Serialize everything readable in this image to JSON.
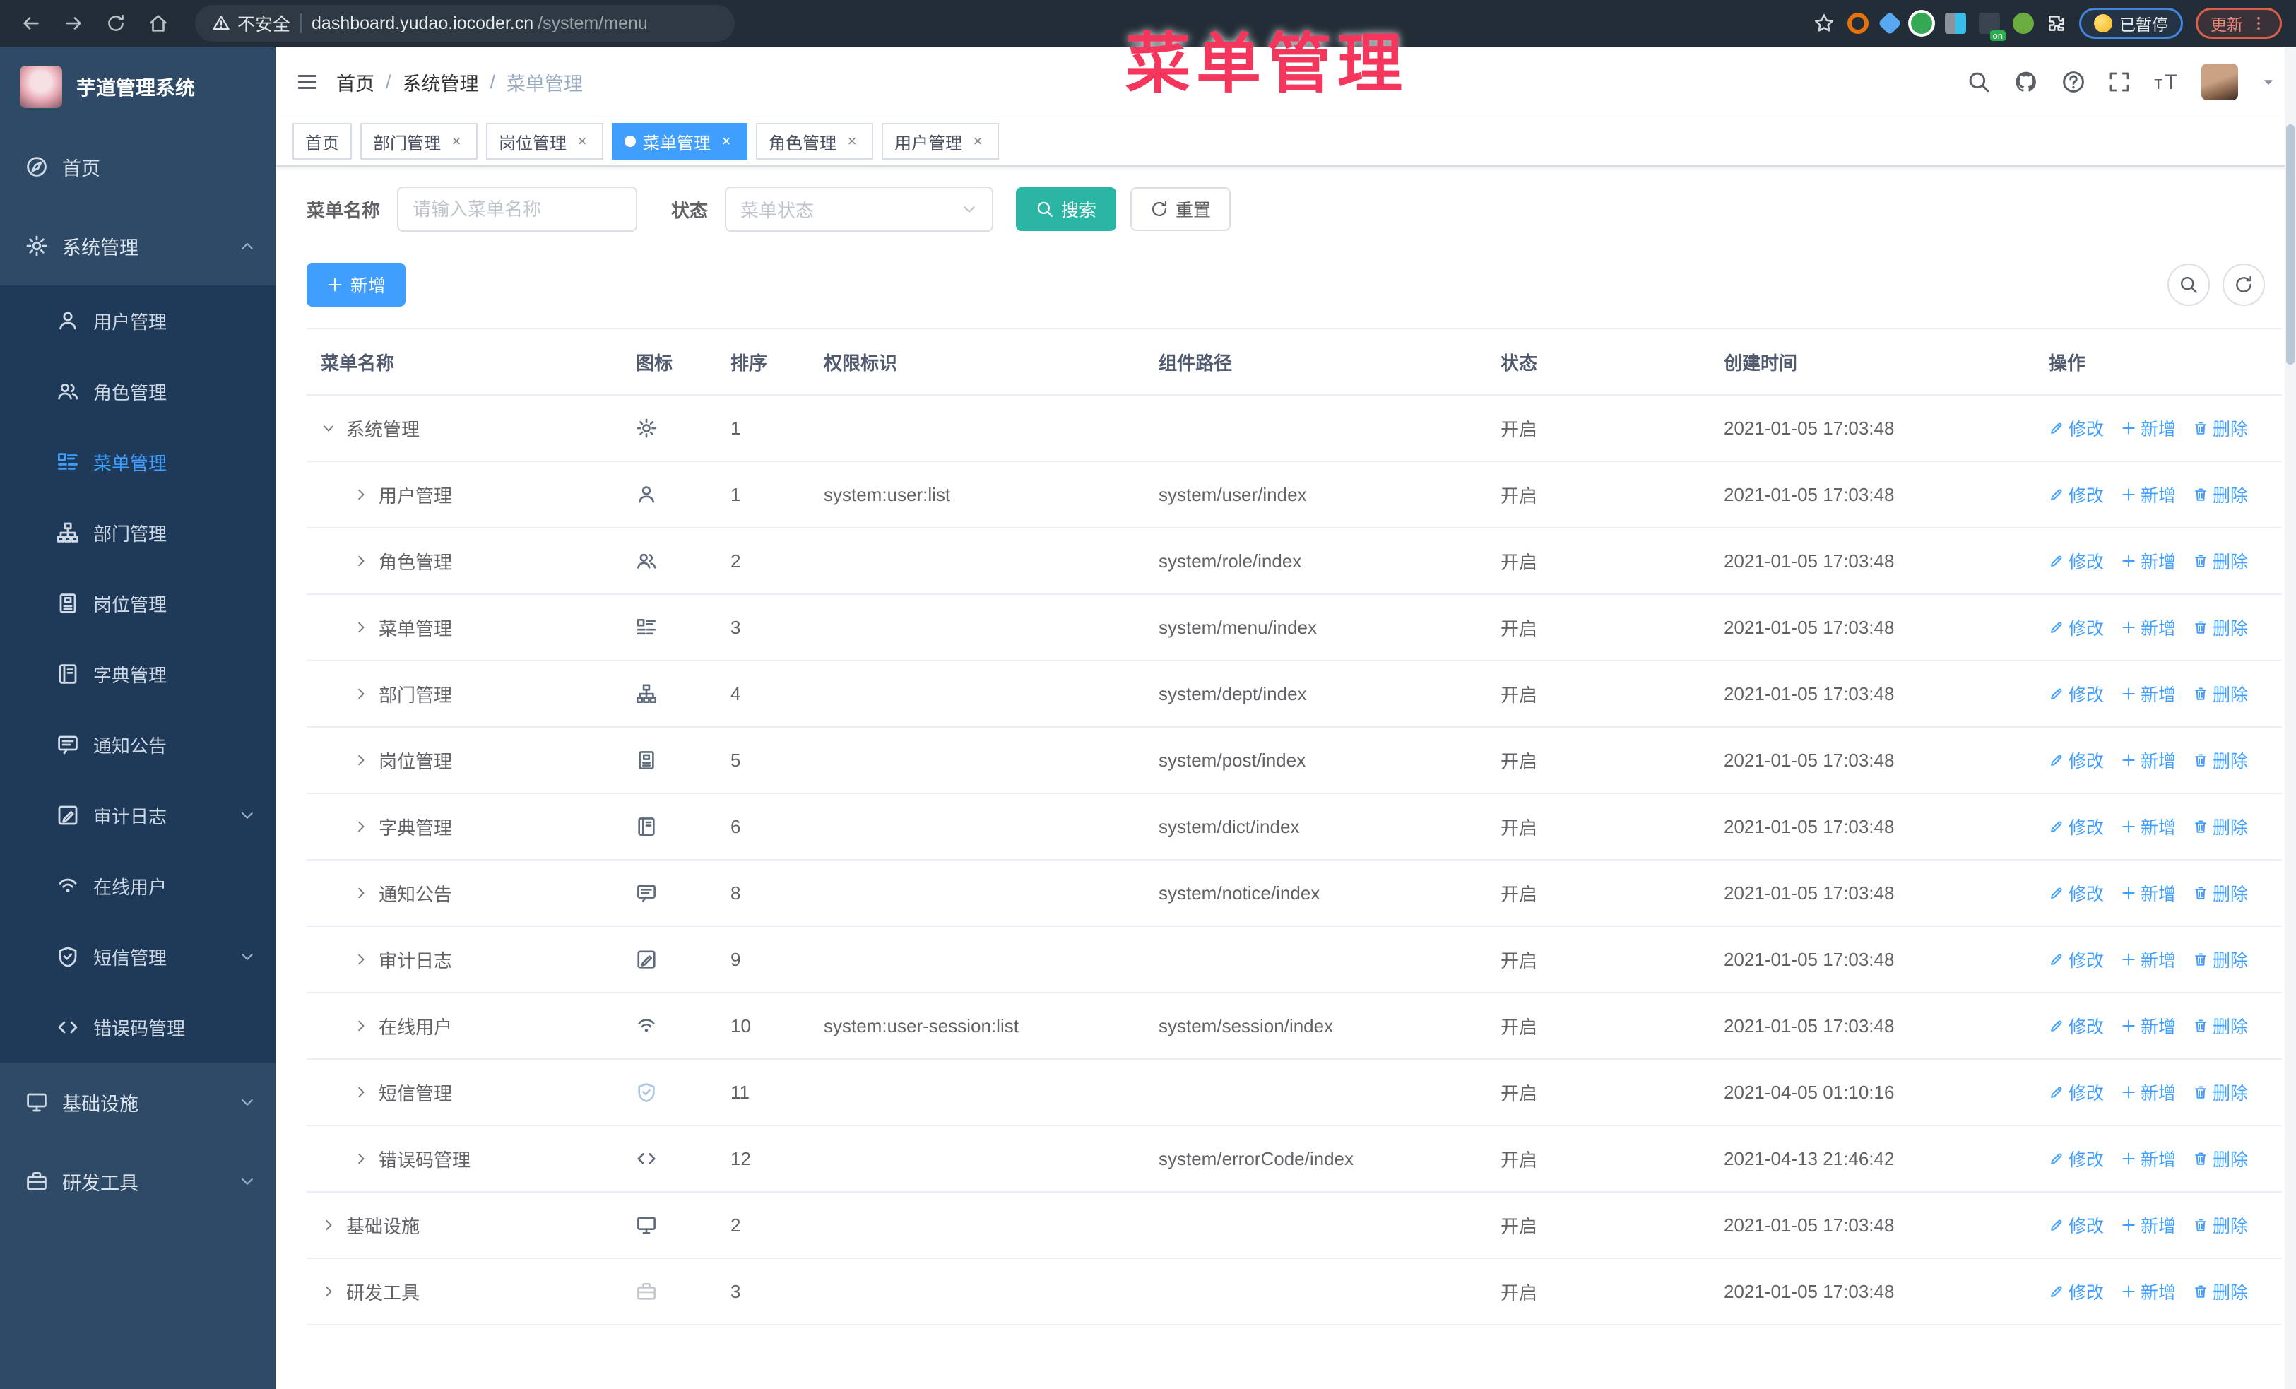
{
  "browser": {
    "security_label": "不安全",
    "url_host": "dashboard.yudao.iocoder.cn",
    "url_path": "/system/menu",
    "paused_badge": "已暂停",
    "update_button": "更新"
  },
  "overlay_title": "菜单管理",
  "colors": {
    "accent": "#409eff",
    "search_button": "#2ab5a5",
    "overlay": "#f4355c",
    "sidebar_bg": "#2e4a66",
    "submenu_bg": "#1e3a58"
  },
  "sidebar": {
    "app_title": "芋道管理系统",
    "items": [
      {
        "key": "home",
        "label": "首页",
        "icon": "guide",
        "level": 0
      },
      {
        "key": "system",
        "label": "系统管理",
        "icon": "gear",
        "level": 0,
        "chevron": "up"
      },
      {
        "key": "user",
        "label": "用户管理",
        "icon": "user",
        "level": 1
      },
      {
        "key": "role",
        "label": "角色管理",
        "icon": "users",
        "level": 1
      },
      {
        "key": "menu",
        "label": "菜单管理",
        "icon": "tree-table",
        "level": 1,
        "active": true
      },
      {
        "key": "dept",
        "label": "部门管理",
        "icon": "org-tree",
        "level": 1
      },
      {
        "key": "post",
        "label": "岗位管理",
        "icon": "id-badge",
        "level": 1
      },
      {
        "key": "dict",
        "label": "字典管理",
        "icon": "book",
        "level": 1
      },
      {
        "key": "notice",
        "label": "通知公告",
        "icon": "message",
        "level": 1
      },
      {
        "key": "audit",
        "label": "审计日志",
        "icon": "edit-doc",
        "level": 1,
        "chevron": "down"
      },
      {
        "key": "online",
        "label": "在线用户",
        "icon": "online",
        "level": 1
      },
      {
        "key": "sms",
        "label": "短信管理",
        "icon": "shield-check",
        "level": 1,
        "chevron": "down"
      },
      {
        "key": "errcode",
        "label": "错误码管理",
        "icon": "code",
        "level": 1
      },
      {
        "key": "infra",
        "label": "基础设施",
        "icon": "monitor",
        "level": 0,
        "chevron": "down"
      },
      {
        "key": "devtools",
        "label": "研发工具",
        "icon": "briefcase",
        "level": 0,
        "chevron": "down"
      }
    ]
  },
  "header": {
    "breadcrumb": [
      "首页",
      "系统管理",
      "菜单管理"
    ]
  },
  "tabs": [
    {
      "key": "home",
      "label": "首页",
      "closable": false,
      "active": false
    },
    {
      "key": "dept",
      "label": "部门管理",
      "closable": true,
      "active": false
    },
    {
      "key": "post",
      "label": "岗位管理",
      "closable": true,
      "active": false
    },
    {
      "key": "menu",
      "label": "菜单管理",
      "closable": true,
      "active": true
    },
    {
      "key": "role",
      "label": "角色管理",
      "closable": true,
      "active": false
    },
    {
      "key": "user",
      "label": "用户管理",
      "closable": true,
      "active": false
    }
  ],
  "filters": {
    "name_label": "菜单名称",
    "name_placeholder": "请输入菜单名称",
    "status_label": "状态",
    "status_placeholder": "菜单状态",
    "search_label": "搜索",
    "reset_label": "重置"
  },
  "toolbar": {
    "add_label": "新增"
  },
  "actions": {
    "edit": "修改",
    "add": "新增",
    "delete": "删除"
  },
  "table": {
    "columns": [
      "菜单名称",
      "图标",
      "排序",
      "权限标识",
      "组件路径",
      "状态",
      "创建时间",
      "操作"
    ],
    "rows": [
      {
        "name": "系统管理",
        "icon": "gear",
        "level": 0,
        "expanded": true,
        "sort": "1",
        "perm": "",
        "path": "",
        "status": "开启",
        "time": "2021-01-05 17:03:48"
      },
      {
        "name": "用户管理",
        "icon": "user",
        "level": 1,
        "expanded": false,
        "sort": "1",
        "perm": "system:user:list",
        "path": "system/user/index",
        "status": "开启",
        "time": "2021-01-05 17:03:48"
      },
      {
        "name": "角色管理",
        "icon": "users",
        "level": 1,
        "expanded": false,
        "sort": "2",
        "perm": "",
        "path": "system/role/index",
        "status": "开启",
        "time": "2021-01-05 17:03:48"
      },
      {
        "name": "菜单管理",
        "icon": "tree-table",
        "level": 1,
        "expanded": false,
        "sort": "3",
        "perm": "",
        "path": "system/menu/index",
        "status": "开启",
        "time": "2021-01-05 17:03:48"
      },
      {
        "name": "部门管理",
        "icon": "org-tree",
        "level": 1,
        "expanded": false,
        "sort": "4",
        "perm": "",
        "path": "system/dept/index",
        "status": "开启",
        "time": "2021-01-05 17:03:48"
      },
      {
        "name": "岗位管理",
        "icon": "id-badge",
        "level": 1,
        "expanded": false,
        "sort": "5",
        "perm": "",
        "path": "system/post/index",
        "status": "开启",
        "time": "2021-01-05 17:03:48"
      },
      {
        "name": "字典管理",
        "icon": "book",
        "level": 1,
        "expanded": false,
        "sort": "6",
        "perm": "",
        "path": "system/dict/index",
        "status": "开启",
        "time": "2021-01-05 17:03:48"
      },
      {
        "name": "通知公告",
        "icon": "message",
        "level": 1,
        "expanded": false,
        "sort": "8",
        "perm": "",
        "path": "system/notice/index",
        "status": "开启",
        "time": "2021-01-05 17:03:48"
      },
      {
        "name": "审计日志",
        "icon": "edit-doc",
        "level": 1,
        "expanded": false,
        "sort": "9",
        "perm": "",
        "path": "",
        "status": "开启",
        "time": "2021-01-05 17:03:48"
      },
      {
        "name": "在线用户",
        "icon": "online",
        "level": 1,
        "expanded": false,
        "sort": "10",
        "perm": "system:user-session:list",
        "path": "system/session/index",
        "status": "开启",
        "time": "2021-01-05 17:03:48"
      },
      {
        "name": "短信管理",
        "icon": "shield-check",
        "level": 1,
        "expanded": false,
        "sort": "11",
        "perm": "",
        "path": "",
        "status": "开启",
        "time": "2021-04-05 01:10:16",
        "icon_color": "#a9c6e2"
      },
      {
        "name": "错误码管理",
        "icon": "code",
        "level": 1,
        "expanded": false,
        "sort": "12",
        "perm": "",
        "path": "system/errorCode/index",
        "status": "开启",
        "time": "2021-04-13 21:46:42"
      },
      {
        "name": "基础设施",
        "icon": "monitor",
        "level": 0,
        "expanded": false,
        "sort": "2",
        "perm": "",
        "path": "",
        "status": "开启",
        "time": "2021-01-05 17:03:48"
      },
      {
        "name": "研发工具",
        "icon": "briefcase",
        "level": 0,
        "expanded": false,
        "sort": "3",
        "perm": "",
        "path": "",
        "status": "开启",
        "time": "2021-01-05 17:03:48",
        "icon_color": "#c3c8cf"
      }
    ]
  }
}
